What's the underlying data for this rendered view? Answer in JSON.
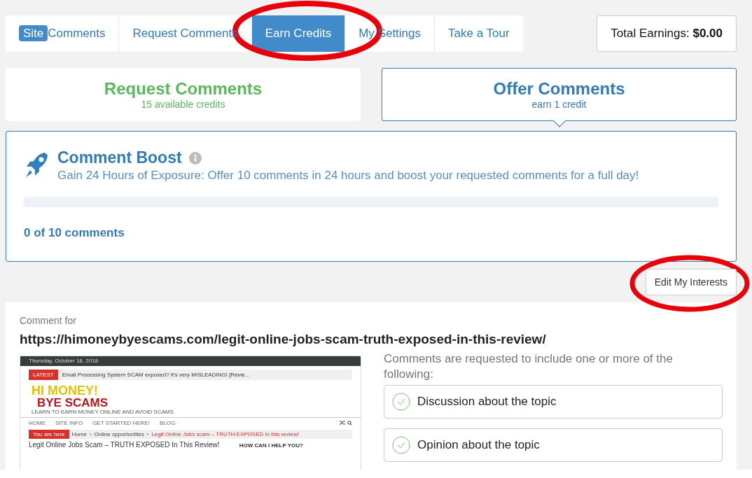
{
  "tabs": [
    {
      "badge": "Site",
      "label": "Comments",
      "selected": false
    },
    {
      "label": "Request Comments",
      "selected": false
    },
    {
      "label": "Earn Credits",
      "selected": true
    },
    {
      "label": "My Settings",
      "selected": false
    },
    {
      "label": "Take a Tour",
      "selected": false
    }
  ],
  "earnings": {
    "label": "Total Earnings:",
    "value": "$0.00"
  },
  "modes": [
    {
      "title": "Request Comments",
      "subtitle": "15 available credits",
      "selected": false
    },
    {
      "title": "Offer Comments",
      "subtitle": "earn 1 credit",
      "selected": true
    }
  ],
  "boost": {
    "title": "Comment Boost",
    "description": "Gain 24 Hours of Exposure: Offer 10 comments in 24 hours and boost your requested comments for a full day!",
    "level": 0,
    "progress_text": "0 of 10 comments"
  },
  "edit_button": "Edit My Interests",
  "comment": {
    "label": "Comment for",
    "url": "https://himoneybyescams.com/legit-online-jobs-scam-truth-exposed-in-this-review/",
    "preview": {
      "date": "Thursday, October 18, 2018",
      "latest_tag": "LATEST",
      "latest_text": "Email Processing System SCAM exposed? It's very MISLEADING! [Revie...",
      "logo_top": "HI MONEY!",
      "logo_bottom": "BYE SCAMS",
      "logo_tagline": "LEARN TO EARN MONEY ONLINE AND AVOID SCAMS",
      "nav": [
        "HOME",
        "SITE INFO",
        "GET STARTED HERE!",
        "BLOG"
      ],
      "breadcrumb_tag": "You are here",
      "breadcrumb_separator": "›",
      "breadcrumb": [
        "Home",
        "Online opportunities",
        "Legit Online Jobs scam – TRUTH EXPOSED in this review!"
      ],
      "article_title": "Legit Online Jobs Scam – TRUTH EXPOSED In This Review!",
      "sidebar_heading": "HOW CAN I HELP YOU?"
    },
    "requirements_intro": "Comments are requested to include one or more of the following:",
    "requirements": [
      "Discussion about the topic",
      "Opinion about the topic"
    ]
  }
}
